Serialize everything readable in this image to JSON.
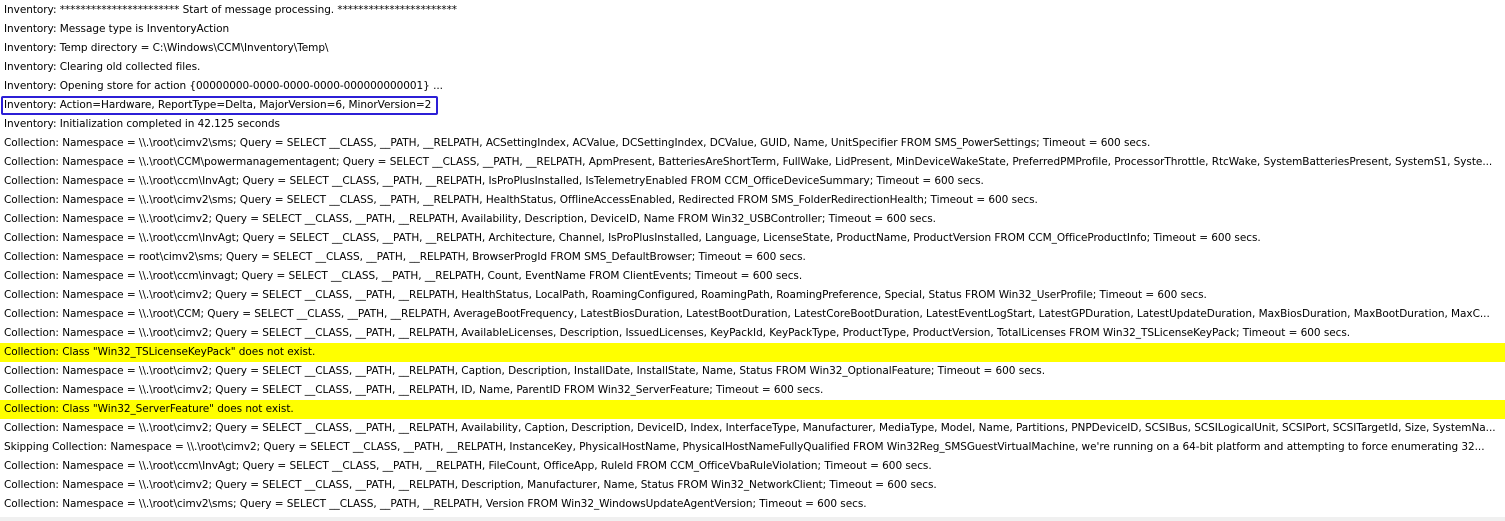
{
  "log": {
    "lines": [
      {
        "text": "Inventory: *********************** Start of message processing. ***********************",
        "highlight": false,
        "selected": false
      },
      {
        "text": "Inventory: Message type is InventoryAction",
        "highlight": false,
        "selected": false
      },
      {
        "text": "Inventory: Temp directory = C:\\Windows\\CCM\\Inventory\\Temp\\",
        "highlight": false,
        "selected": false
      },
      {
        "text": "Inventory: Clearing old collected files.",
        "highlight": false,
        "selected": false
      },
      {
        "text": "Inventory: Opening store for action {00000000-0000-0000-0000-000000000001} ...",
        "highlight": false,
        "selected": false
      },
      {
        "text": "Inventory: Action=Hardware, ReportType=Delta, MajorVersion=6, MinorVersion=2",
        "highlight": false,
        "selected": true
      },
      {
        "text": "Inventory: Initialization completed in 42.125 seconds",
        "highlight": false,
        "selected": false
      },
      {
        "text": "Collection: Namespace = \\\\.\\root\\cimv2\\sms; Query = SELECT __CLASS, __PATH, __RELPATH, ACSettingIndex, ACValue, DCSettingIndex, DCValue, GUID, Name, UnitSpecifier FROM SMS_PowerSettings; Timeout = 600 secs.",
        "highlight": false,
        "selected": false
      },
      {
        "text": "Collection: Namespace = \\\\.\\root\\CCM\\powermanagementagent; Query = SELECT __CLASS, __PATH, __RELPATH, ApmPresent, BatteriesAreShortTerm, FullWake, LidPresent, MinDeviceWakeState, PreferredPMProfile, ProcessorThrottle, RtcWake, SystemBatteriesPresent, SystemS1, Syste...",
        "highlight": false,
        "selected": false
      },
      {
        "text": "Collection: Namespace = \\\\.\\root\\ccm\\InvAgt; Query = SELECT __CLASS, __PATH, __RELPATH, IsProPlusInstalled, IsTelemetryEnabled FROM CCM_OfficeDeviceSummary; Timeout = 600 secs.",
        "highlight": false,
        "selected": false
      },
      {
        "text": "Collection: Namespace = \\\\.\\root\\cimv2\\sms; Query = SELECT __CLASS, __PATH, __RELPATH, HealthStatus, OfflineAccessEnabled, Redirected FROM SMS_FolderRedirectionHealth; Timeout = 600 secs.",
        "highlight": false,
        "selected": false
      },
      {
        "text": "Collection: Namespace = \\\\.\\root\\cimv2; Query = SELECT __CLASS, __PATH, __RELPATH, Availability, Description, DeviceID, Name FROM Win32_USBController; Timeout = 600 secs.",
        "highlight": false,
        "selected": false
      },
      {
        "text": "Collection: Namespace = \\\\.\\root\\ccm\\InvAgt; Query = SELECT __CLASS, __PATH, __RELPATH, Architecture, Channel, IsProPlusInstalled, Language, LicenseState, ProductName, ProductVersion FROM CCM_OfficeProductInfo; Timeout = 600 secs.",
        "highlight": false,
        "selected": false
      },
      {
        "text": "Collection: Namespace = root\\cimv2\\sms; Query = SELECT __CLASS, __PATH, __RELPATH, BrowserProgId FROM SMS_DefaultBrowser; Timeout = 600 secs.",
        "highlight": false,
        "selected": false
      },
      {
        "text": "Collection: Namespace = \\\\.\\root\\ccm\\invagt; Query = SELECT __CLASS, __PATH, __RELPATH, Count, EventName FROM ClientEvents; Timeout = 600 secs.",
        "highlight": false,
        "selected": false
      },
      {
        "text": "Collection: Namespace = \\\\.\\root\\cimv2; Query = SELECT __CLASS, __PATH, __RELPATH, HealthStatus, LocalPath, RoamingConfigured, RoamingPath, RoamingPreference, Special, Status FROM Win32_UserProfile; Timeout = 600 secs.",
        "highlight": false,
        "selected": false
      },
      {
        "text": "Collection: Namespace = \\\\.\\root\\CCM; Query = SELECT __CLASS, __PATH, __RELPATH, AverageBootFrequency, LatestBiosDuration, LatestBootDuration, LatestCoreBootDuration, LatestEventLogStart, LatestGPDuration, LatestUpdateDuration, MaxBiosDuration, MaxBootDuration, MaxC...",
        "highlight": false,
        "selected": false
      },
      {
        "text": "Collection: Namespace = \\\\.\\root\\cimv2; Query = SELECT __CLASS, __PATH, __RELPATH, AvailableLicenses, Description, IssuedLicenses, KeyPackId, KeyPackType, ProductType, ProductVersion, TotalLicenses FROM Win32_TSLicenseKeyPack; Timeout = 600 secs.",
        "highlight": false,
        "selected": false
      },
      {
        "text": "Collection: Class \"Win32_TSLicenseKeyPack\" does not exist.",
        "highlight": true,
        "selected": false
      },
      {
        "text": "Collection: Namespace = \\\\.\\root\\cimv2; Query = SELECT __CLASS, __PATH, __RELPATH, Caption, Description, InstallDate, InstallState, Name, Status FROM Win32_OptionalFeature; Timeout = 600 secs.",
        "highlight": false,
        "selected": false
      },
      {
        "text": "Collection: Namespace = \\\\.\\root\\cimv2; Query = SELECT __CLASS, __PATH, __RELPATH, ID, Name, ParentID FROM Win32_ServerFeature; Timeout = 600 secs.",
        "highlight": false,
        "selected": false
      },
      {
        "text": "Collection: Class \"Win32_ServerFeature\" does not exist.",
        "highlight": true,
        "selected": false
      },
      {
        "text": "Collection: Namespace = \\\\.\\root\\cimv2; Query = SELECT __CLASS, __PATH, __RELPATH, Availability, Caption, Description, DeviceID, Index, InterfaceType, Manufacturer, MediaType, Model, Name, Partitions, PNPDeviceID, SCSIBus, SCSILogicalUnit, SCSIPort, SCSITargetId, Size, SystemNa...",
        "highlight": false,
        "selected": false
      },
      {
        "text": "Skipping Collection: Namespace = \\\\.\\root\\cimv2; Query = SELECT __CLASS, __PATH, __RELPATH, InstanceKey, PhysicalHostName, PhysicalHostNameFullyQualified FROM Win32Reg_SMSGuestVirtualMachine, we're running on a 64-bit platform and attempting to force enumerating 32...",
        "highlight": false,
        "selected": false
      },
      {
        "text": "Collection: Namespace = \\\\.\\root\\ccm\\InvAgt; Query = SELECT __CLASS, __PATH, __RELPATH, FileCount, OfficeApp, RuleId FROM CCM_OfficeVbaRuleViolation; Timeout = 600 secs.",
        "highlight": false,
        "selected": false
      },
      {
        "text": "Collection: Namespace = \\\\.\\root\\cimv2; Query = SELECT __CLASS, __PATH, __RELPATH, Description, Manufacturer, Name, Status FROM Win32_NetworkClient; Timeout = 600 secs.",
        "highlight": false,
        "selected": false
      },
      {
        "text": "Collection: Namespace = \\\\.\\root\\cimv2\\sms; Query = SELECT __CLASS, __PATH, __RELPATH, Version FROM Win32_WindowsUpdateAgentVersion; Timeout = 600 secs.",
        "highlight": false,
        "selected": false
      }
    ]
  },
  "colors": {
    "highlight": "#ffff00",
    "selection_border": "#2c1fd6",
    "text": "#000000",
    "background": "#ffffff"
  }
}
